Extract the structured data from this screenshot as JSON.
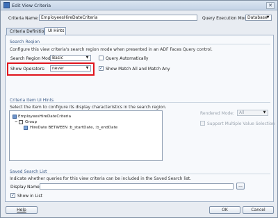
{
  "window": {
    "title": "Edit View Criteria",
    "close_glyph": "✕"
  },
  "header": {
    "criteria_name_label": "Criteria Name:",
    "criteria_name_value": "EmployeesHireDateCriteria",
    "query_mode_label": "Query Execution Mode:",
    "query_mode_value": "Database"
  },
  "tabs": [
    {
      "label": "Criteria Definition",
      "active": false
    },
    {
      "label": "UI Hints",
      "active": true
    }
  ],
  "search_region": {
    "title": "Search Region",
    "description": "Configure this view criteria's search region mode when presented in an ADF Faces Query control.",
    "mode_label": "Search Region Mode:",
    "mode_value": "Basic",
    "query_auto_label": "Query Automatically",
    "query_auto_checked": false,
    "show_ops_label": "Show Operators:",
    "show_ops_value": "never",
    "match_all_label": "Show Match All and Match Any",
    "match_all_checked": true
  },
  "item_hints": {
    "title": "Criteria Item UI Hints",
    "description": "Select the item to configure its display characteristics in the search region.",
    "tree": {
      "root": "EmployeesHireDateCriteria",
      "group": "Group",
      "item": "HireDate BETWEEN :b_startDate, :b_endDate"
    },
    "rendered_mode_label": "Rendered Mode:",
    "rendered_mode_value": "All",
    "multi_select_label": "Support Multiple Value Selection"
  },
  "saved_search": {
    "title": "Saved Search List",
    "description": "Indicate whether queries for this view criteria can be included in the Saved Search list.",
    "display_name_label": "Display Name:",
    "display_name_value": "",
    "browse_label": "...",
    "show_in_list_label": "Show in List",
    "show_in_list_checked": true
  },
  "footer": {
    "help": "Help",
    "ok": "OK",
    "cancel": "Cancel"
  },
  "glyphs": {
    "dropdown": "▼",
    "check": "✓",
    "collapse": "−"
  }
}
